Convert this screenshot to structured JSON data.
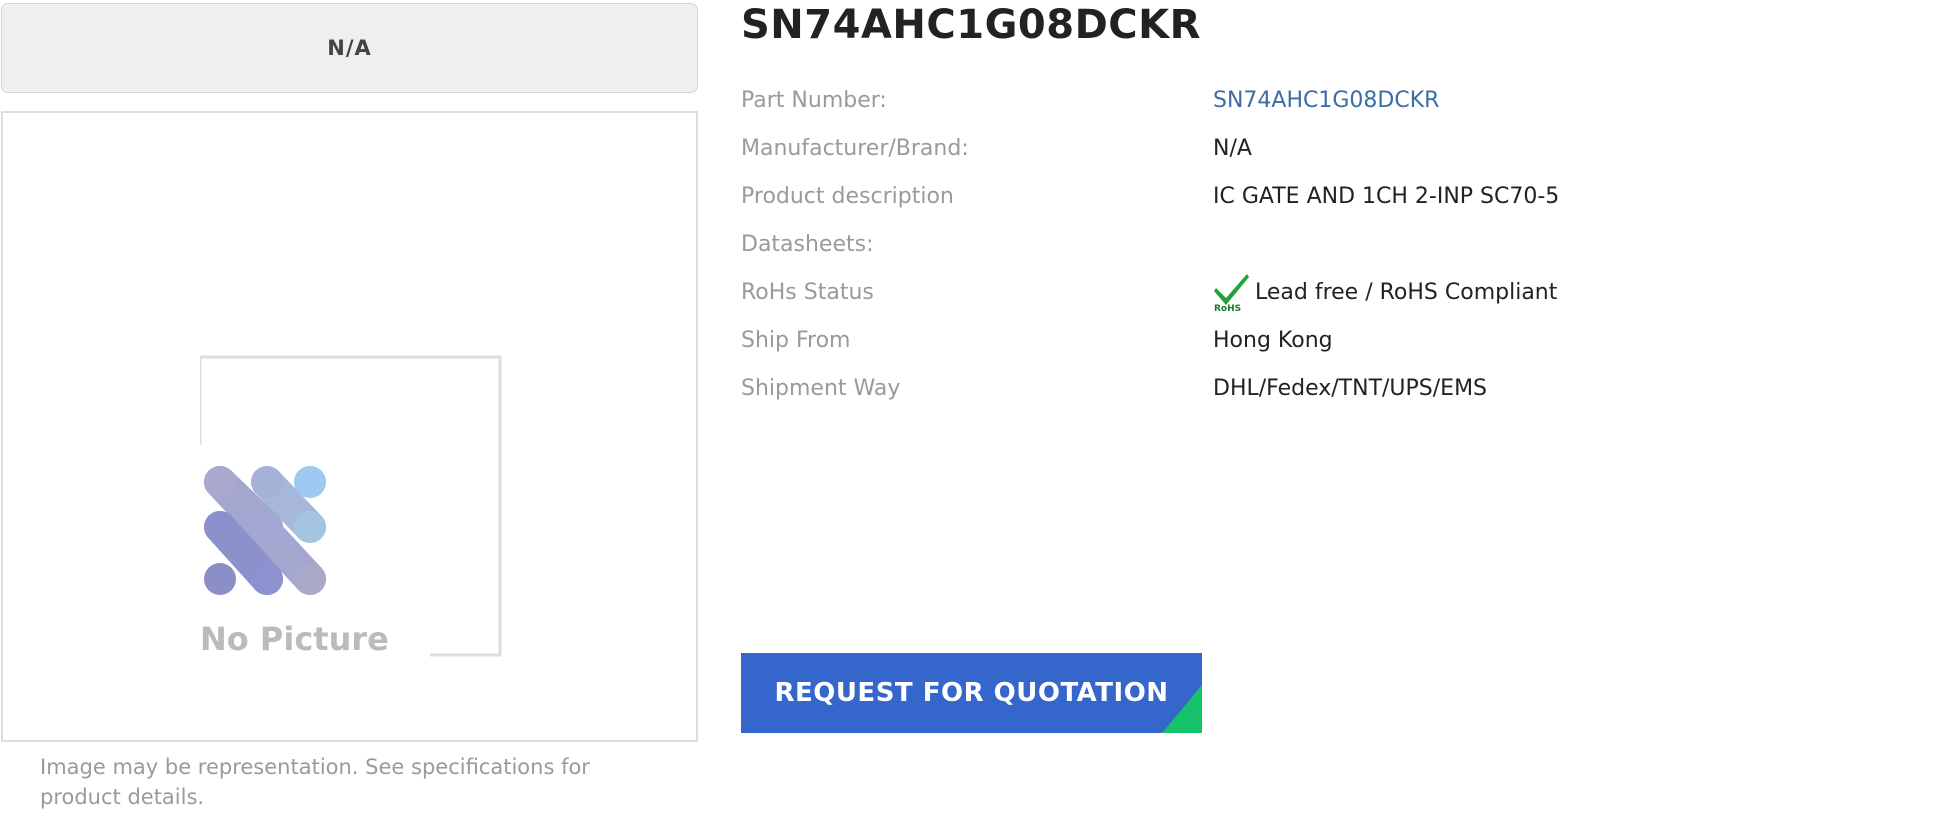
{
  "brand": {
    "label": "N/A"
  },
  "image": {
    "no_picture_text": "No Picture",
    "caption": "Image may be representation. See specifications for product details."
  },
  "product": {
    "title": "SN74AHC1G08DCKR",
    "specs": [
      {
        "label": "Part Number:",
        "value": "SN74AHC1G08DCKR"
      },
      {
        "label": "Manufacturer/Brand:",
        "value": "N/A"
      },
      {
        "label": "Product description",
        "value": "IC GATE AND 1CH 2-INP SC70-5"
      },
      {
        "label": "Datasheets:",
        "value": ""
      },
      {
        "label": "RoHs Status",
        "value": "Lead free / RoHS Compliant",
        "icon_text": "RoHS"
      },
      {
        "label": "Ship From",
        "value": "Hong Kong"
      },
      {
        "label": "Shipment Way",
        "value": "DHL/Fedex/TNT/UPS/EMS"
      }
    ]
  },
  "actions": {
    "rfq_label": "REQUEST FOR QUOTATION"
  },
  "colors": {
    "link": "#3a6ea5",
    "button": "#3466cc",
    "button_accent": "#16c26a",
    "check": "#22a23a"
  },
  "icons": {
    "rohs": "check-icon",
    "placeholder": "no-picture-icon"
  }
}
